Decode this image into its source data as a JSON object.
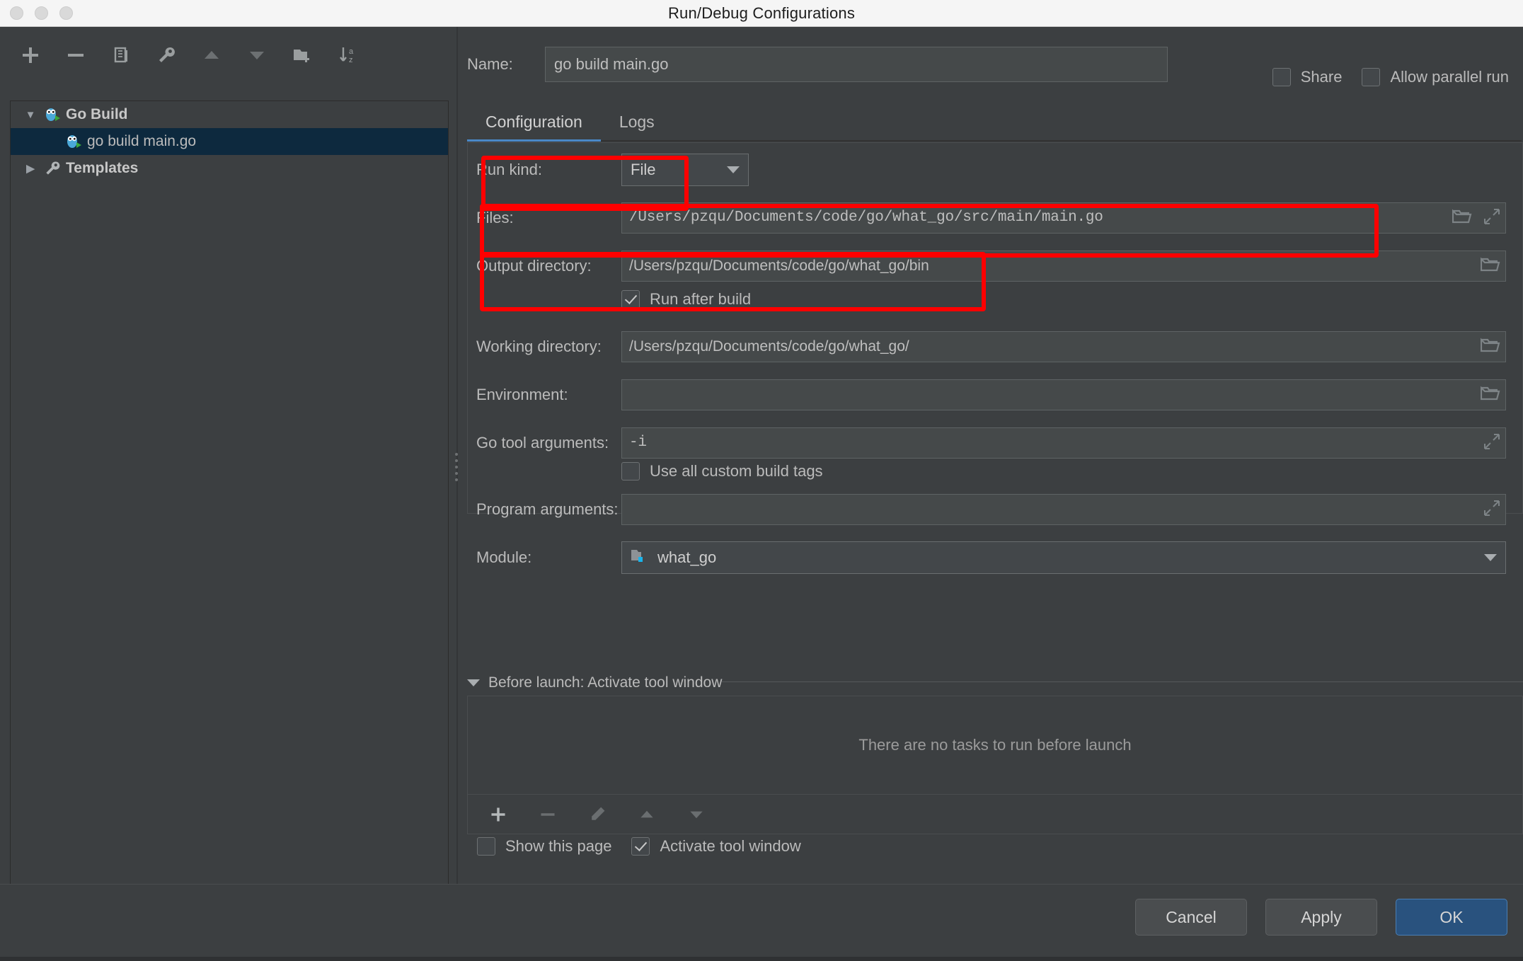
{
  "window": {
    "title": "Run/Debug Configurations"
  },
  "sidebar": {
    "toolbar": [
      {
        "name": "add-button",
        "icon": "plus-icon"
      },
      {
        "name": "remove-button",
        "icon": "minus-icon"
      },
      {
        "name": "copy-configuration-button",
        "icon": "copy-icon"
      },
      {
        "name": "edit-templates-button",
        "icon": "wrench-icon"
      },
      {
        "name": "move-up-button",
        "icon": "triangle-up-icon"
      },
      {
        "name": "move-down-button",
        "icon": "triangle-down-icon"
      },
      {
        "name": "new-folder-button",
        "icon": "folder-plus-icon"
      },
      {
        "name": "sort-alphabetically-button",
        "icon": "sort-az-icon"
      }
    ],
    "tree": [
      {
        "label": "Go Build",
        "icon": "go-gopher-icon",
        "twisty": "▼",
        "level": 0,
        "selected": false,
        "bold": true
      },
      {
        "label": "go build main.go",
        "icon": "go-gopher-icon",
        "twisty": "",
        "level": 1,
        "selected": true,
        "bold": false
      },
      {
        "label": "Templates",
        "icon": "wrench-icon",
        "twisty": "▶",
        "level": 0,
        "selected": false,
        "bold": true
      }
    ],
    "help_label": "?"
  },
  "header": {
    "name_label": "Name:",
    "name_value": "go build main.go",
    "share": {
      "label": "Share",
      "checked": false
    },
    "allow_parallel_run": {
      "label": "Allow parallel run",
      "checked": false
    }
  },
  "tabs": [
    {
      "label": "Configuration",
      "active": true
    },
    {
      "label": "Logs",
      "active": false
    }
  ],
  "form": {
    "run_kind": {
      "label": "Run kind:",
      "value": "File",
      "highlighted": true
    },
    "files": {
      "label": "Files:",
      "value": "/Users/pzqu/Documents/code/go/what_go/src/main/main.go",
      "highlighted": true
    },
    "output_directory": {
      "label": "Output directory:",
      "value": "/Users/pzqu/Documents/code/go/what_go/bin",
      "highlighted": true
    },
    "run_after_build": {
      "label": "Run after build",
      "checked": true
    },
    "working_directory": {
      "label": "Working directory:",
      "value": "/Users/pzqu/Documents/code/go/what_go/"
    },
    "environment": {
      "label": "Environment:",
      "value": ""
    },
    "go_tool_arguments": {
      "label": "Go tool arguments:",
      "value": "-i"
    },
    "use_all_custom_build_tags": {
      "label": "Use all custom build tags",
      "checked": false
    },
    "program_arguments": {
      "label": "Program arguments:",
      "value": ""
    },
    "module": {
      "label": "Module:",
      "value": "what_go"
    }
  },
  "before_launch": {
    "title": "Before launch: Activate tool window",
    "empty_text": "There are no tasks to run before launch",
    "toolbar": [
      {
        "name": "add-task-button",
        "icon": "plus-icon",
        "enabled": true
      },
      {
        "name": "remove-task-button",
        "icon": "minus-icon",
        "enabled": false
      },
      {
        "name": "edit-task-button",
        "icon": "pencil-icon",
        "enabled": false
      },
      {
        "name": "move-task-up-button",
        "icon": "triangle-up-icon",
        "enabled": false
      },
      {
        "name": "move-task-down-button",
        "icon": "triangle-down-icon",
        "enabled": false
      }
    ],
    "show_this_page": {
      "label": "Show this page",
      "checked": false
    },
    "activate_tool_window": {
      "label": "Activate tool window",
      "checked": true
    }
  },
  "footer": {
    "cancel": "Cancel",
    "apply": "Apply",
    "ok": "OK"
  },
  "colors": {
    "background": "#3c3f41",
    "field_background": "#45494a",
    "selection": "#0d293e",
    "accent": "#4a88c7",
    "primary_button": "#29527e",
    "annotation": "#ff0000",
    "text": "#bbbbbb"
  }
}
